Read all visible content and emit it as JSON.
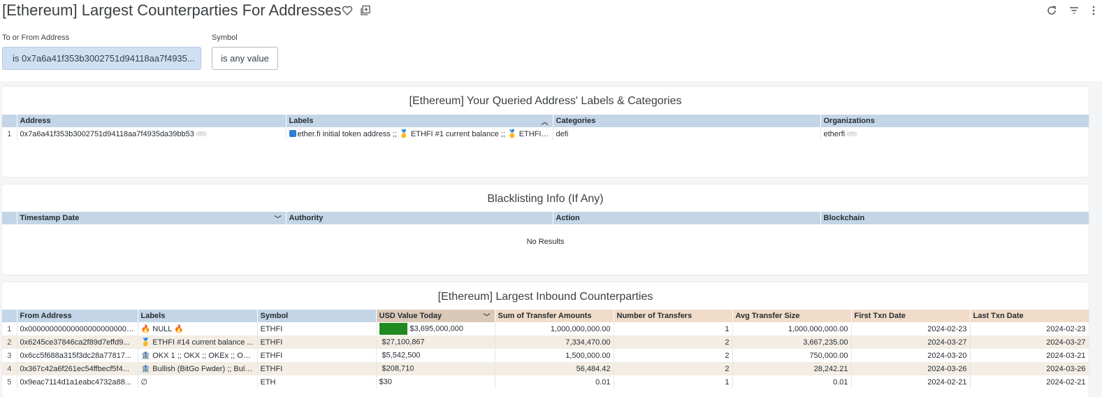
{
  "page": {
    "title": "[Ethereum] Largest Counterparties For Addresses"
  },
  "filters": {
    "address_label": "To or From Address",
    "address_value": "is 0x7a6a41f353b3002751d94118aa7f4935...",
    "symbol_label": "Symbol",
    "symbol_value": "is any value"
  },
  "labels_tile": {
    "title": "[Ethereum] Your Queried Address' Labels & Categories",
    "columns": [
      "Address",
      "Labels",
      "Categories",
      "Organizations"
    ],
    "rows": [
      {
        "n": "1",
        "address": "0x7a6a41f353b3002751d94118aa7f4935da39bb53",
        "labels": "ether.fi initial token address ;; 🥇 ETHFI #1 current balance ;; 🥇 ETHFI #...",
        "categories": "defi",
        "organizations": "etherfi"
      }
    ]
  },
  "blacklist_tile": {
    "title": "Blacklisting Info (If Any)",
    "columns": [
      "Timestamp Date",
      "Authority",
      "Action",
      "Blockchain"
    ],
    "empty_text": "No Results"
  },
  "inbound_tile": {
    "title": "[Ethereum] Largest Inbound Counterparties",
    "columns": [
      "From Address",
      "Labels",
      "Symbol",
      "USD Value Today",
      "Sum of Transfer Amounts",
      "Number of Transfers",
      "Avg Transfer Size",
      "First Txn Date",
      "Last Txn Date"
    ],
    "rows": [
      {
        "n": "1",
        "from": "0x000000000000000000000000000000...",
        "labels": "🔥 NULL 🔥",
        "symbol": "ETHFI",
        "usd": "$3,695,000,000",
        "usd_fraction": 1.0,
        "sum": "1,000,000,000.00",
        "count": "1",
        "avg": "1,000,000,000.00",
        "first": "2024-02-23",
        "last": "2024-02-23"
      },
      {
        "n": "2",
        "from": "0x6245ce37846ca2f89d7effd9...",
        "labels": "🥇 ETHFI #14 current balance ...",
        "symbol": "ETHFI",
        "usd": "$27,100,867",
        "usd_fraction": 0.0073,
        "sum": "7,334,470.00",
        "count": "2",
        "avg": "3,667,235.00",
        "first": "2024-03-27",
        "last": "2024-03-27"
      },
      {
        "n": "3",
        "from": "0x6cc5f688a315f3dc28a77817...",
        "labels": "🏦 OKX 1 ;; OKX ;; OKEx ;; OKEx...",
        "symbol": "ETHFI",
        "usd": "$5,542,500",
        "usd_fraction": 0.0015,
        "sum": "1,500,000.00",
        "count": "2",
        "avg": "750,000.00",
        "first": "2024-03-20",
        "last": "2024-03-21"
      },
      {
        "n": "4",
        "from": "0x367c42a6f261ec54ffbecf5f4...",
        "labels": "🏦 Bullish (BitGo Fwder) ;; Bulli...",
        "symbol": "ETHFI",
        "usd": "$208,710",
        "usd_fraction": 0.0001,
        "sum": "56,484.42",
        "count": "2",
        "avg": "28,242.21",
        "first": "2024-03-26",
        "last": "2024-03-26"
      },
      {
        "n": "5",
        "from": "0x9eac7114d1a1eabc4732a88...",
        "labels": "∅",
        "symbol": "ETH",
        "usd": "$30",
        "usd_fraction": 0.0,
        "sum": "0.01",
        "count": "1",
        "avg": "0.01",
        "first": "2024-02-21",
        "last": "2024-02-21"
      }
    ]
  },
  "colors": {
    "header_blue": "#c3d5e6",
    "header_peach": "#f0dcc8",
    "row_alt": "#f4ede4",
    "bar_green": "#1f8a1f",
    "filter_active": "#d0e0f3"
  }
}
